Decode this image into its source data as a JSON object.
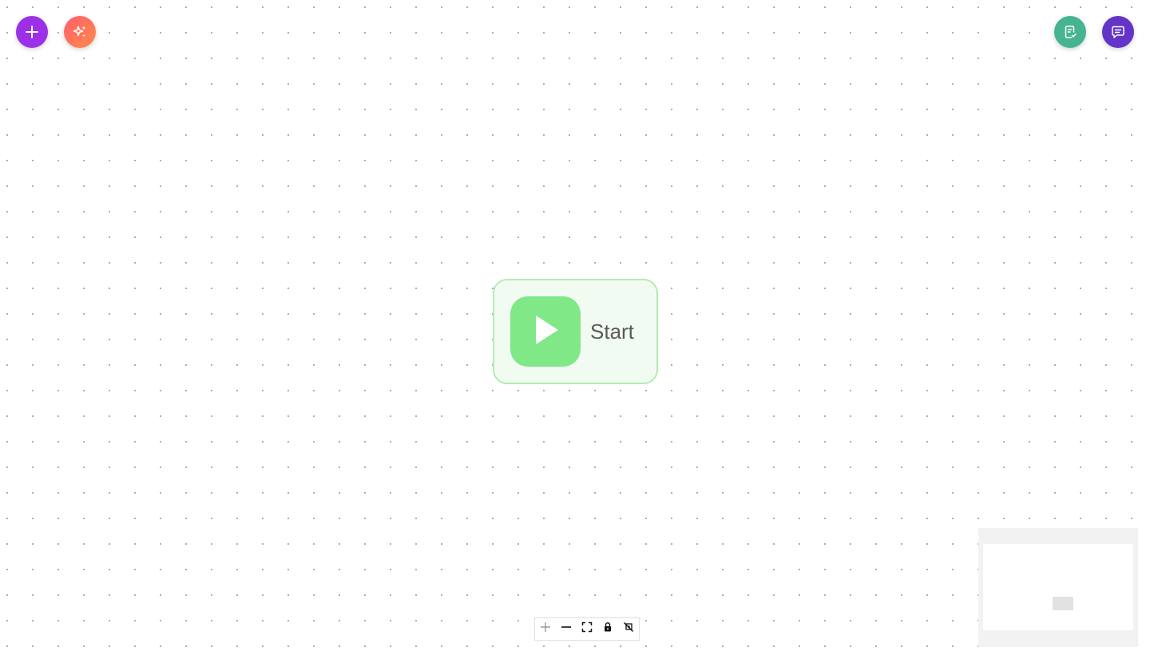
{
  "toolbar": {
    "add_icon": "plus-icon",
    "ai_icon": "sparkles-icon",
    "checklist_icon": "clipboard-check-icon",
    "chat_icon": "chat-bubble-icon"
  },
  "colors": {
    "add_button": "#9b30e8",
    "ai_button_gradient": [
      "#ff5f6d",
      "#ff8a4a"
    ],
    "checklist_button": "#46b492",
    "chat_button": "#6334c8",
    "start_node_border": "#b3ecb3",
    "start_node_background": "#f2fbf2",
    "start_icon_background": "#80e887"
  },
  "start_node": {
    "label": "Start",
    "icon": "play-icon"
  },
  "controls": {
    "buttons": [
      "zoom-in",
      "zoom-out",
      "fit-view",
      "lock",
      "interactivity-toggle"
    ]
  }
}
